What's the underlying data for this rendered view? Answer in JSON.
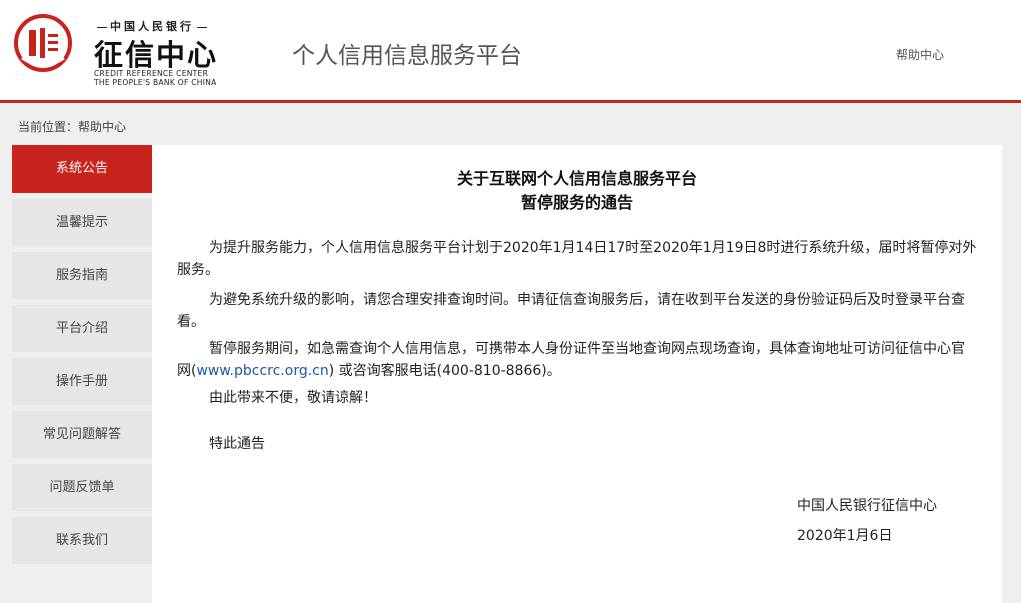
{
  "header": {
    "logo_top_text": "中国人民银行",
    "logo_main_text": "征信中心",
    "logo_en_line1": "CREDIT REFERENCE CENTER",
    "logo_en_line2": "THE PEOPLE'S BANK OF CHINA",
    "platform_title": "个人信用信息服务平台",
    "help_link": "帮助中心",
    "accent_color": "#c9231d"
  },
  "breadcrumb": "当前位置：帮助中心",
  "sidebar": {
    "items": [
      {
        "label": "系统公告",
        "active": true
      },
      {
        "label": "温馨提示"
      },
      {
        "label": "服务指南"
      },
      {
        "label": "平台介绍"
      },
      {
        "label": "操作手册"
      },
      {
        "label": "常见问题解答"
      },
      {
        "label": "问题反馈单"
      },
      {
        "label": "联系我们"
      }
    ]
  },
  "notice": {
    "title_line1": "关于互联网个人信用信息服务平台",
    "title_line2": "暂停服务的通告",
    "para1": "为提升服务能力，个人信用信息服务平台计划于2020年1月14日17时至2020年1月19日8时进行系统升级，届时将暂停对外服务。",
    "para2": "为避免系统升级的影响，请您合理安排查询时间。申请征信查询服务后，请在收到平台发送的身份验证码后及时登录平台查看。",
    "para3_before": "暂停服务期间，如急需查询个人信用信息，可携带本人身份证件至当地查询网点现场查询，具体查询地址可访问征信中心官网(",
    "para3_link": "www.pbccrc.org.cn",
    "para3_after": ") 或咨询客服电话(400-810-8866)。",
    "para4": "由此带来不便，敬请谅解！",
    "para5": "特此通告",
    "signer": "中国人民银行征信中心",
    "date": "2020年1月6日"
  }
}
